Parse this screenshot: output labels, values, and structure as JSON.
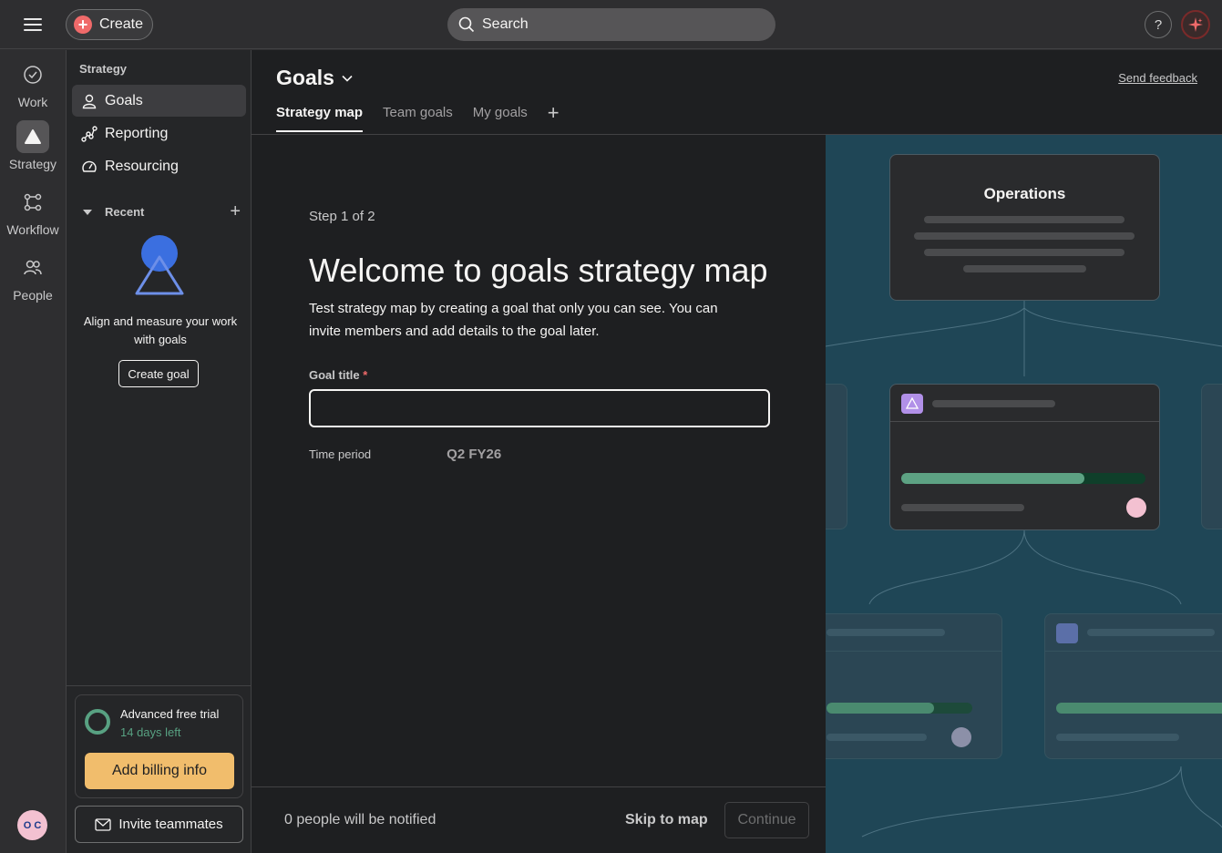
{
  "topbar": {
    "create_label": "Create",
    "search_placeholder": "Search",
    "help_label": "?"
  },
  "rail": {
    "items": [
      {
        "label": "Work",
        "icon": "check-circle-icon"
      },
      {
        "label": "Strategy",
        "icon": "triangle-icon"
      },
      {
        "label": "Workflow",
        "icon": "workflow-icon"
      },
      {
        "label": "People",
        "icon": "people-icon"
      }
    ],
    "avatar_initials": "O C"
  },
  "sidebar": {
    "heading": "Strategy",
    "items": [
      {
        "label": "Goals",
        "icon": "person-icon"
      },
      {
        "label": "Reporting",
        "icon": "reporting-icon"
      },
      {
        "label": "Resourcing",
        "icon": "gauge-icon"
      }
    ],
    "recent_label": "Recent",
    "empty_text": "Align and measure your work with goals",
    "create_goal_label": "Create goal",
    "trial": {
      "title": "Advanced free trial",
      "days_left": "14 days left",
      "billing_label": "Add billing info"
    },
    "invite_label": "Invite teammates"
  },
  "main": {
    "title": "Goals",
    "feedback_label": "Send feedback",
    "tabs": [
      {
        "label": "Strategy map"
      },
      {
        "label": "Team goals"
      },
      {
        "label": "My goals"
      }
    ]
  },
  "form": {
    "step": "Step 1 of 2",
    "heading": "Welcome to goals strategy map",
    "description": "Test strategy map by creating a goal that only you can see. You can invite members and add details to the goal later.",
    "goal_title_label": "Goal title",
    "required_mark": "*",
    "goal_title_value": "",
    "time_period_label": "Time period",
    "time_period_value": "Q2 FY26"
  },
  "footer": {
    "notified_text": "0 people will be notified",
    "skip_label": "Skip to map",
    "continue_label": "Continue"
  },
  "preview": {
    "ops_title": "Operations",
    "progress": 0.75,
    "colors": {
      "progress": "#5da283",
      "track": "#0f3f2a",
      "goal_icon": "#b190e8"
    }
  }
}
